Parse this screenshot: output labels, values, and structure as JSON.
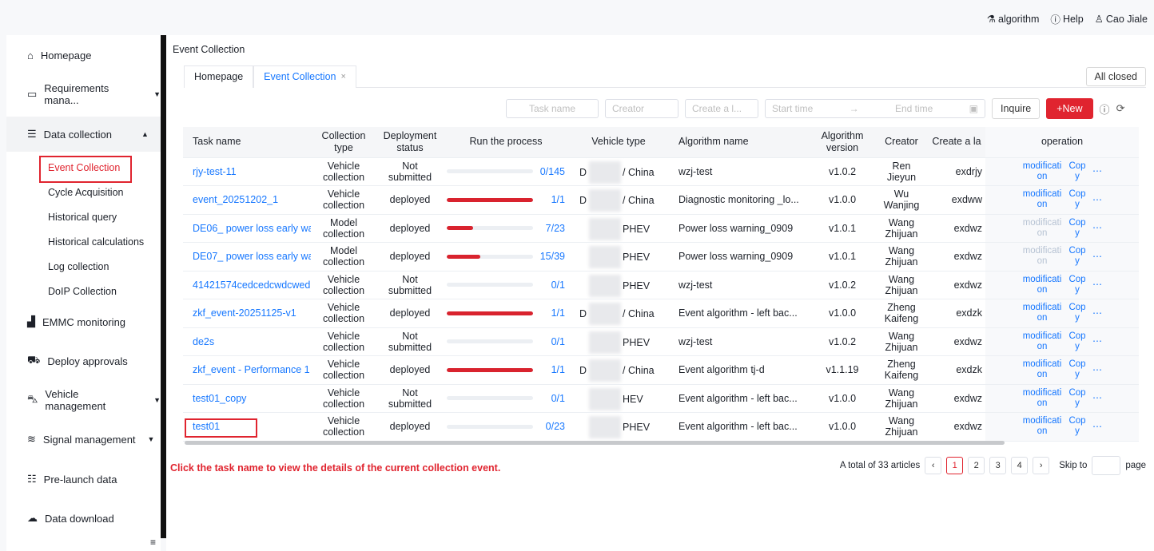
{
  "header": {
    "algorithm": "algorithm",
    "help": "Help",
    "user": "Cao Jiale"
  },
  "sidebar": {
    "homepage": "Homepage",
    "requirements": "Requirements mana...",
    "data_collection": "Data collection",
    "sub": [
      "Event Collection",
      "Cycle Acquisition",
      "Historical query",
      "Historical calculations",
      "Log collection",
      "DoIP Collection"
    ],
    "emmc": "EMMC monitoring",
    "deploy": "Deploy approvals",
    "vehicle": "Vehicle management",
    "signal": "Signal management",
    "prelaunch": "Pre-launch data",
    "download": "Data download"
  },
  "breadcrumb": "Event Collection",
  "tabs": [
    {
      "label": "Homepage"
    },
    {
      "label": "Event Collection"
    }
  ],
  "all_closed": "All closed",
  "filters": {
    "task_name": "Task name",
    "creator": "Creator",
    "create": "Create a l...",
    "start_time": "Start time",
    "end_time": "End time",
    "inquire": "Inquire",
    "new": "+New"
  },
  "columns": [
    "Task name",
    "Collection type",
    "Deployment status",
    "Run the process",
    "Vehicle type",
    "Algorithm name",
    "Algorithm version",
    "Creator",
    "Create a la",
    "operation"
  ],
  "rows": [
    {
      "task": "rjy-test-11",
      "type": "Vehicle collection",
      "status": "Not submitted",
      "progress": 0,
      "ptext": "0/145",
      "vprefix": "D",
      "vtype": "/ China",
      "alg": "wzj-test",
      "ver": "v1.0.2",
      "creator": "Ren Jieyun",
      "cl": "exdrjy",
      "op1": "modification",
      "op2": "Copy",
      "op_disabled": false
    },
    {
      "task": "event_20251202_1",
      "type": "Vehicle collection",
      "status": "deployed",
      "progress": 1,
      "ptext": "1/1",
      "vprefix": "D",
      "vtype": "/ China",
      "alg": "Diagnostic monitoring _lo...",
      "ver": "v1.0.0",
      "creator": "Wu Wanjing",
      "cl": "exdww",
      "op1": "modification",
      "op2": "Copy",
      "op_disabled": false
    },
    {
      "task": "DE06_ power loss early wa...",
      "type": "Model collection",
      "status": "deployed",
      "progress": 0.3043,
      "ptext": "7/23",
      "vprefix": "",
      "vtype": "PHEV",
      "alg": "Power loss warning_0909",
      "ver": "v1.0.1",
      "creator": "Wang Zhijuan",
      "cl": "exdwz",
      "op1": "modification",
      "op2": "Copy",
      "op_disabled": true
    },
    {
      "task": "DE07_ power loss early wa...",
      "type": "Model collection",
      "status": "deployed",
      "progress": 0.3846,
      "ptext": "15/39",
      "vprefix": "",
      "vtype": "PHEV",
      "alg": "Power loss warning_0909",
      "ver": "v1.0.1",
      "creator": "Wang Zhijuan",
      "cl": "exdwz",
      "op1": "modification",
      "op2": "Copy",
      "op_disabled": true
    },
    {
      "task": "41421574cedcedcwdcwed...",
      "type": "Vehicle collection",
      "status": "Not submitted",
      "progress": 0,
      "ptext": "0/1",
      "vprefix": "",
      "vtype": "PHEV",
      "alg": "wzj-test",
      "ver": "v1.0.2",
      "creator": "Wang Zhijuan",
      "cl": "exdwz",
      "op1": "modification",
      "op2": "Copy",
      "op_disabled": false
    },
    {
      "task": "zkf_event-20251125-v1",
      "type": "Vehicle collection",
      "status": "deployed",
      "progress": 1,
      "ptext": "1/1",
      "vprefix": "D",
      "vtype": "/ China",
      "alg": "Event algorithm - left bac...",
      "ver": "v1.0.0",
      "creator": "Zheng Kaifeng",
      "cl": "exdzk",
      "op1": "modification",
      "op2": "Copy",
      "op_disabled": false
    },
    {
      "task": "de2s",
      "type": "Vehicle collection",
      "status": "Not submitted",
      "progress": 0,
      "ptext": "0/1",
      "vprefix": "",
      "vtype": "PHEV",
      "alg": "wzj-test",
      "ver": "v1.0.2",
      "creator": "Wang Zhijuan",
      "cl": "exdwz",
      "op1": "modification",
      "op2": "Copy",
      "op_disabled": false
    },
    {
      "task": "zkf_event - Performance 1",
      "type": "Vehicle collection",
      "status": "deployed",
      "progress": 1,
      "ptext": "1/1",
      "vprefix": "D",
      "vtype": "/ China",
      "alg": "Event algorithm tj-d",
      "ver": "v1.1.19",
      "creator": "Zheng Kaifeng",
      "cl": "exdzk",
      "op1": "modification",
      "op2": "Copy",
      "op_disabled": false
    },
    {
      "task": "test01_copy",
      "type": "Vehicle collection",
      "status": "Not submitted",
      "progress": 0,
      "ptext": "0/1",
      "vprefix": "",
      "vtype": "HEV",
      "alg": "Event algorithm - left bac...",
      "ver": "v1.0.0",
      "creator": "Wang Zhijuan",
      "cl": "exdwz",
      "op1": "modification",
      "op2": "Copy",
      "op_disabled": false
    },
    {
      "task": "test01",
      "type": "Vehicle collection",
      "status": "deployed",
      "progress": 0,
      "ptext": "0/23",
      "vprefix": "",
      "vtype": "PHEV",
      "alg": "Event algorithm - left bac...",
      "ver": "v1.0.0",
      "creator": "Wang Zhijuan",
      "cl": "exdwz",
      "op1": "modification",
      "op2": "Copy",
      "op_disabled": false
    }
  ],
  "hint": "Click the task name to view the details of the current collection event.",
  "pagination": {
    "total": "A total of 33 articles",
    "pages": [
      "1",
      "2",
      "3",
      "4"
    ],
    "skip_to": "Skip to",
    "page": "page"
  },
  "colors": {
    "accent": "#e0242f",
    "link": "#1677ff"
  }
}
